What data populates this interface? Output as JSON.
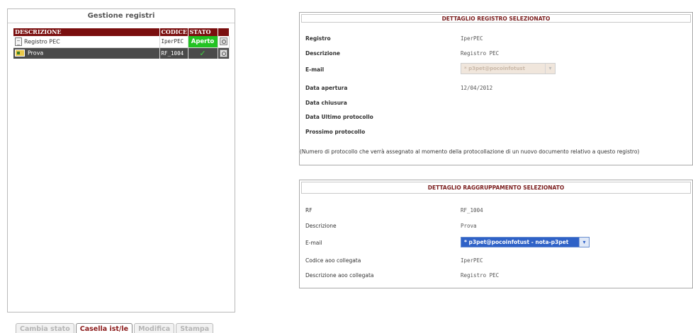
{
  "registry_panel": {
    "title": "Gestione registri",
    "headers": {
      "descrizione": "DESCRIZIONE",
      "codice": "CODICE",
      "stato": "STATO"
    },
    "rows": [
      {
        "descrizione": "Registro PEC",
        "codice": "IperPEC",
        "stato": "Aperto",
        "icon": "document-icon",
        "selected": false
      },
      {
        "descrizione": "Prova",
        "codice": "RF_1004",
        "stato": "✓",
        "icon": "group-icon",
        "selected": true
      }
    ]
  },
  "tabs": [
    {
      "label": "Cambia stato",
      "active": false
    },
    {
      "label": "Casella ist/le",
      "active": true
    },
    {
      "label": "Modifica",
      "active": false
    },
    {
      "label": "Stampa",
      "active": false
    }
  ],
  "registro_detail": {
    "title": "DETTAGLIO REGISTRO SELEZIONATO",
    "fields": {
      "registro": {
        "label": "Registro",
        "value": "IperPEC"
      },
      "descrizione": {
        "label": "Descrizione",
        "value": "Registro PEC"
      },
      "email": {
        "label": "E-mail",
        "value": "* p3pet@pocoinfotust"
      },
      "data_apertura": {
        "label": "Data apertura",
        "value": "12/04/2012"
      },
      "data_chiusura": {
        "label": "Data chiusura",
        "value": ""
      },
      "data_ultimo_protocollo": {
        "label": "Data Ultimo protocollo",
        "value": ""
      },
      "prossimo_protocollo": {
        "label": "Prossimo protocollo",
        "value": ""
      }
    },
    "note": "(Numero di protocollo che verrà assegnato al momento della protocollazione di un nuovo documento relativo a questo registro)"
  },
  "raggruppamento_detail": {
    "title": "DETTAGLIO RAGGRUPPAMENTO SELEZIONATO",
    "fields": {
      "rf": {
        "label": "RF",
        "value": "RF_1004"
      },
      "descrizione": {
        "label": "Descrizione",
        "value": "Prova"
      },
      "email": {
        "label": "E-mail",
        "value": "* p3pet@pocoinfotust - nota-p3pet"
      },
      "codice_aoo": {
        "label": "Codice aoo collegata",
        "value": "IperPEC"
      },
      "descrizione_aoo": {
        "label": "Descrizione aoo collegata",
        "value": "Registro PEC"
      }
    }
  },
  "colors": {
    "header_bg": "#7a0e0e",
    "selected_row_bg": "#4a4a4a",
    "status_open": "#22c322",
    "tab_active_text": "#8b1a1a",
    "select_highlight": "#2f62c7"
  }
}
